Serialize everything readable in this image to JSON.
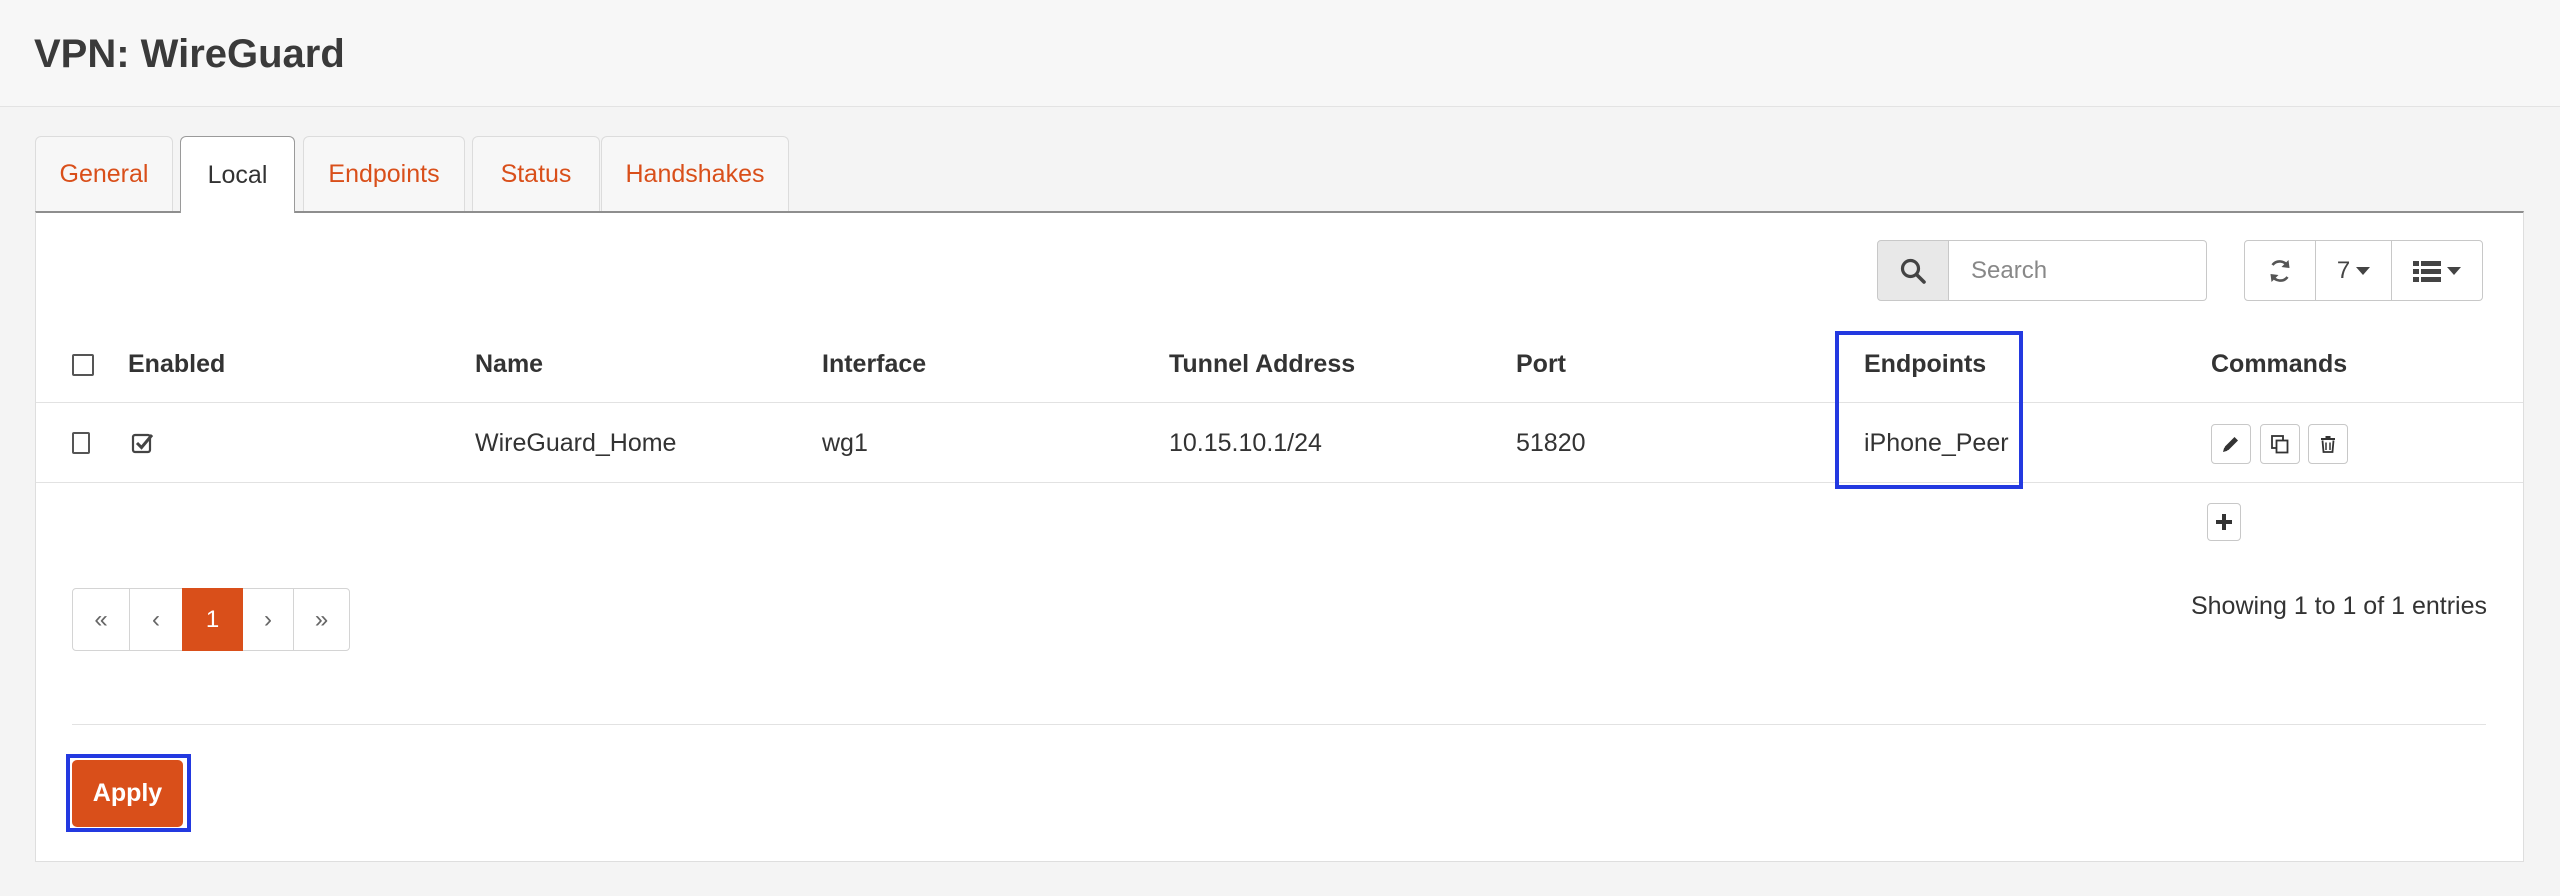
{
  "header": {
    "title": "VPN: WireGuard"
  },
  "tabs": [
    {
      "label": "General"
    },
    {
      "label": "Local"
    },
    {
      "label": "Endpoints"
    },
    {
      "label": "Status"
    },
    {
      "label": "Handshakes"
    }
  ],
  "active_tab": "Local",
  "toolbar": {
    "search_placeholder": "Search",
    "rows_per_page": "7",
    "icons": [
      "search-icon",
      "refresh-icon",
      "list-columns-icon"
    ]
  },
  "table": {
    "columns": [
      "Enabled",
      "Name",
      "Interface",
      "Tunnel Address",
      "Port",
      "Endpoints",
      "Commands"
    ],
    "rows": [
      {
        "selected": false,
        "enabled": true,
        "name": "WireGuard_Home",
        "interface": "wg1",
        "tunnel_address": "10.15.10.1/24",
        "port": "51820",
        "endpoints": "iPhone_Peer"
      }
    ],
    "row_commands": [
      "edit-icon",
      "copy-icon",
      "delete-icon"
    ],
    "add_icon": "plus-icon"
  },
  "pagination": {
    "first": "«",
    "prev": "‹",
    "current": "1",
    "next": "›",
    "last": "»",
    "info": "Showing 1 to 1 of 1 entries"
  },
  "footer": {
    "apply_label": "Apply"
  },
  "colors": {
    "accent": "#d94f1a",
    "highlight": "#2339e0"
  }
}
